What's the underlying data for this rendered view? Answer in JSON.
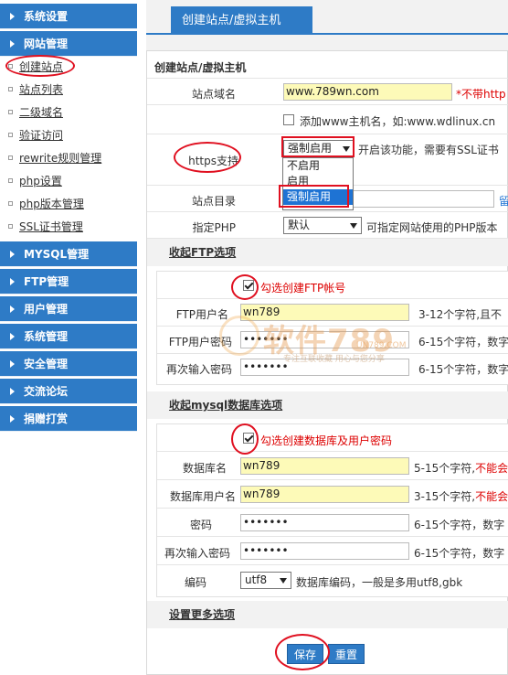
{
  "sidebar": {
    "groups": [
      {
        "label": "系统设置"
      },
      {
        "label": "网站管理"
      },
      {
        "label": "MYSQL管理"
      },
      {
        "label": "FTP管理"
      },
      {
        "label": "用户管理"
      },
      {
        "label": "系统管理"
      },
      {
        "label": "安全管理"
      },
      {
        "label": "交流论坛"
      },
      {
        "label": "捐赠打赏"
      }
    ],
    "site_items": [
      {
        "label": "创建站点"
      },
      {
        "label": "站点列表"
      },
      {
        "label": "二级域名"
      },
      {
        "label": "验证访问"
      },
      {
        "label": "rewrite规则管理"
      },
      {
        "label": "php设置"
      },
      {
        "label": "php版本管理"
      },
      {
        "label": "SSL证书管理"
      }
    ]
  },
  "main": {
    "tab": "创建站点/虚拟主机",
    "panel_title": "创建站点/虚拟主机",
    "domain": {
      "label": "站点域名",
      "value": "www.789wn.com",
      "hint": "*不带http"
    },
    "www": {
      "text": "添加www主机名，如:www.wdlinux.cn"
    },
    "https": {
      "label": "https支持",
      "selected": "强制启用",
      "hint": "开启该功能，需要有SSL证书",
      "options": [
        "不启用",
        "启用",
        "强制启用"
      ]
    },
    "dir": {
      "label": "站点目录",
      "link": "留"
    },
    "php": {
      "label": "指定PHP",
      "selected": "默认",
      "hint": "可指定网站使用的PHP版本"
    },
    "ftp_section": "收起FTP选项",
    "ftp_check": "勾选创建FTP帐号",
    "ftp_user": {
      "label": "FTP用户名",
      "value": "wn789",
      "hint": "3-12个字符,且不"
    },
    "ftp_pass": {
      "label": "FTP用户密码",
      "value": "•••••••",
      "hint": "6-15个字符，数字"
    },
    "ftp_pass2": {
      "label": "再次输入密码",
      "value": "•••••••",
      "hint": "6-15个字符，数字"
    },
    "mysql_section": "收起mysql数据库选项",
    "mysql_check": "勾选创建数据库及用户密码",
    "db_name": {
      "label": "数据库名",
      "value": "wn789",
      "hint": "5-15个字符,",
      "hint_red": "不能会"
    },
    "db_user": {
      "label": "数据库用户名",
      "value": "wn789",
      "hint": "3-15个字符,",
      "hint_red": "不能会"
    },
    "db_pass": {
      "label": "密码",
      "value": "•••••••",
      "hint": "6-15个字符，数字"
    },
    "db_pass2": {
      "label": "再次输入密码",
      "value": "•••••••",
      "hint": "6-15个字符，数字"
    },
    "charset": {
      "label": "编码",
      "selected": "utf8",
      "hint": "数据库编码，一般是多用utf8,gbk"
    },
    "more_section": "设置更多选项",
    "save_label": "保存",
    "reset_label": "重置"
  },
  "watermark": {
    "text": "软件789",
    "site": "UN789.COM",
    "slogan": "专注互联收藏   用心与您分享"
  }
}
